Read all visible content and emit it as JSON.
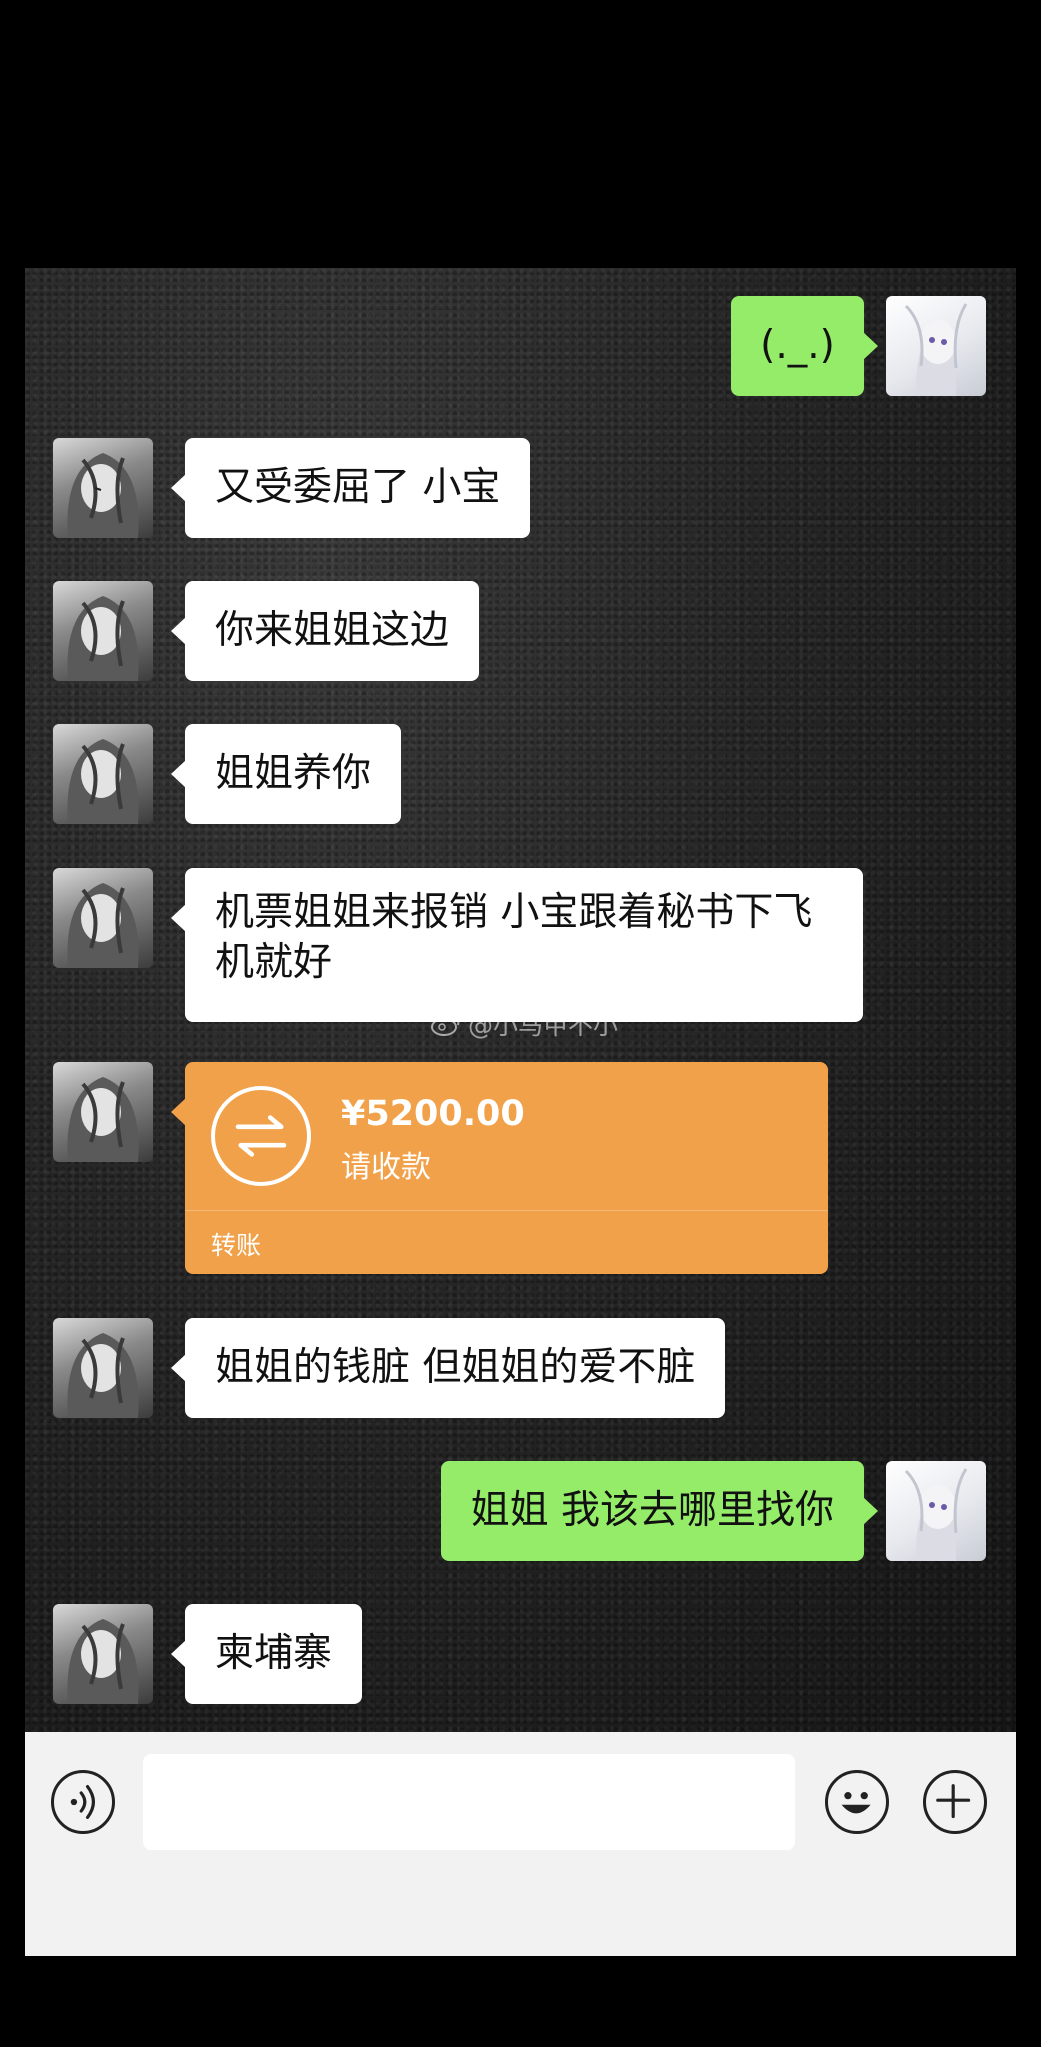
{
  "messages": [
    {
      "side": "self",
      "text": "(._.)"
    },
    {
      "side": "other",
      "text": "又受委屈了 小宝"
    },
    {
      "side": "other",
      "text": "你来姐姐这边"
    },
    {
      "side": "other",
      "text": "姐姐养你"
    },
    {
      "side": "other",
      "text": "机票姐姐来报销 小宝跟着秘书下飞机就好"
    },
    {
      "side": "other",
      "type": "transfer"
    },
    {
      "side": "other",
      "text": "姐姐的钱脏 但姐姐的爱不脏"
    },
    {
      "side": "self",
      "text": "姐姐 我该去哪里找你"
    },
    {
      "side": "other",
      "text": "柬埔寨"
    }
  ],
  "transfer": {
    "amount": "¥5200.00",
    "status": "请收款",
    "label": "转账"
  },
  "watermark": "@小马甲不小",
  "colors": {
    "self_bubble": "#95ec69",
    "other_bubble": "#ffffff",
    "transfer": "#f1a14a",
    "background": "#000000"
  },
  "input_bar": {
    "voice_icon": "voice-icon",
    "emoji_icon": "emoji-icon",
    "plus_icon": "plus-icon",
    "input_value": ""
  }
}
